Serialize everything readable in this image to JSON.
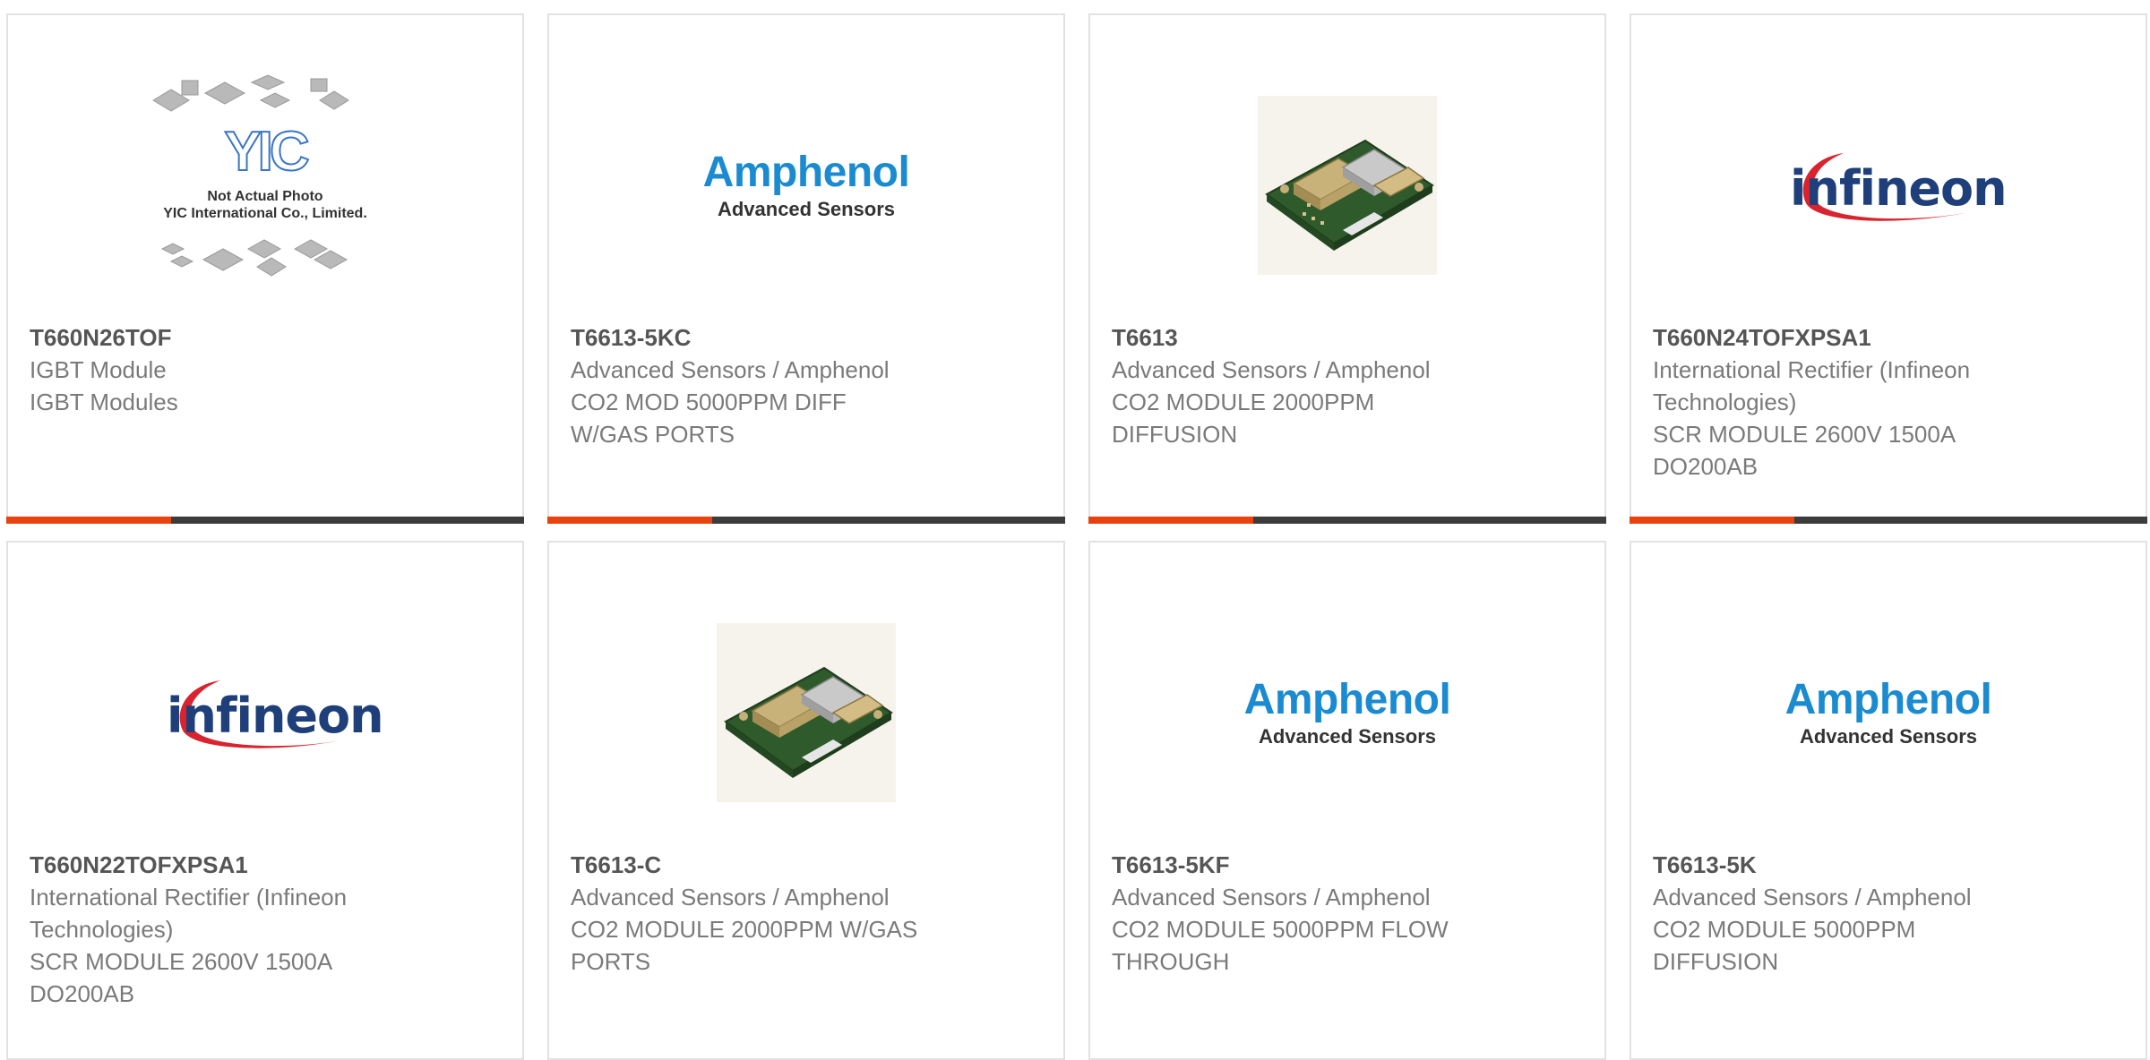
{
  "products": [
    {
      "part": "T660N26TOF",
      "lines": [
        "IGBT Module",
        "IGBT Modules"
      ],
      "image": "yic-placeholder",
      "image_caption": [
        "Not Actual Photo",
        "YIC International Co., Limited."
      ],
      "image_logo": "YIC"
    },
    {
      "part": "T6613-5KC",
      "lines": [
        "Advanced Sensors / Amphenol",
        "CO2 MOD 5000PPM DIFF",
        "W/GAS PORTS"
      ],
      "image": "amphenol-logo"
    },
    {
      "part": "T6613",
      "lines": [
        "Advanced Sensors / Amphenol",
        "CO2 MODULE 2000PPM",
        "DIFFUSION"
      ],
      "image": "sensor-photo"
    },
    {
      "part": "T660N24TOFXPSA1",
      "lines": [
        "International Rectifier (Infineon",
        "Technologies)",
        "SCR MODULE 2600V 1500A",
        "DO200AB"
      ],
      "image": "infineon-logo"
    },
    {
      "part": "T660N22TOFXPSA1",
      "lines": [
        "International Rectifier (Infineon",
        "Technologies)",
        "SCR MODULE 2600V 1500A",
        "DO200AB"
      ],
      "image": "infineon-logo"
    },
    {
      "part": "T6613-C",
      "lines": [
        "Advanced Sensors / Amphenol",
        "CO2 MODULE 2000PPM W/GAS",
        "PORTS"
      ],
      "image": "sensor-photo"
    },
    {
      "part": "T6613-5KF",
      "lines": [
        "Advanced Sensors / Amphenol",
        "CO2 MODULE 5000PPM FLOW",
        "THROUGH"
      ],
      "image": "amphenol-logo"
    },
    {
      "part": "T6613-5K",
      "lines": [
        "Advanced Sensors / Amphenol",
        "CO2 MODULE 5000PPM",
        "DIFFUSION"
      ],
      "image": "amphenol-logo"
    }
  ],
  "logos": {
    "amphenol": {
      "name": "Amphenol",
      "sub": "Advanced Sensors"
    },
    "infineon": {
      "name": "infineon"
    }
  },
  "colors": {
    "accent": "#e8430f",
    "bar": "#3c3c3c",
    "amphenol_blue": "#1a8bd0",
    "infineon_red": "#d9232e"
  }
}
